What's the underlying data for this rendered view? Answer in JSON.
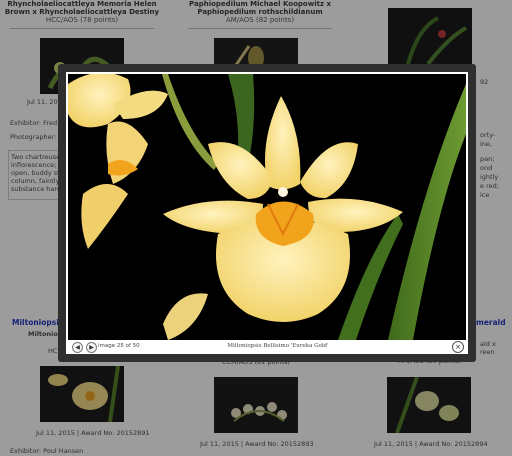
{
  "awards": {
    "col1": {
      "title_line1": "Rhyncholaeliocattleya Memoria Helen",
      "title_line2": "Brown x Rhyncholaeliocattleya Destiny",
      "award": "HCC/AOS (78 points)",
      "date_partial": "Jul 11, 201",
      "exhibitor_partial": "Exhibitor: Fred",
      "photographer_partial": "Photographer: St",
      "desc_line1": "Two chartreuse",
      "desc_line2": "inflorescence; s",
      "desc_line3": "open, buddy sta",
      "desc_line4": "column, faintly r",
      "desc_line5": "substance hard"
    },
    "col2": {
      "title_line1": "Paphiopedilum Michael Koopowitz x",
      "title_line2": "Paphiopedilum rothschildianum",
      "award": "AM/AOS (82 points)"
    },
    "col3": {
      "award_partial": "92",
      "desc_line1": "orty-",
      "desc_line2": "ine,",
      "desc_line3": "pan;",
      "desc_line4": "ond",
      "desc_line5": "ightly",
      "desc_line6": "e red;",
      "desc_line7": "ice"
    },
    "row2": {
      "col1_link_partial": "Miltoniopsis",
      "col1_sub_partial1": "Miltonio",
      "col1_sub_partial2": "HC",
      "col1_date": "Jul 11, 2015 | Award No: 20152891",
      "col1_exhibitor": "Exhibitor: Poul Hansen",
      "col2_award_partial": "CCM/AOS (81 points)",
      "col2_date": "Jul 11, 2015 | Award No: 20152893",
      "col3_link_partial": "merald",
      "col3_sub_partial1": "ald x",
      "col3_sub_partial2": "reen",
      "col3_award_partial": "AM/AOS (80 points)",
      "col3_date": "Jul 11, 2015 | Award No: 20152894"
    }
  },
  "lightbox": {
    "prev_symbol": "◀",
    "next_symbol": "▶",
    "counter": "image 25 of 50",
    "caption": "Miltoniopsis Bellisimo 'Eureka Gold'",
    "close_symbol": "×"
  },
  "colors": {
    "link_blue": "#1a2fbf",
    "flower_yellow": "#f7e08a",
    "flower_center": "#f2a31c",
    "photo_bg": "#000000",
    "leaf_green": "#4f7a22"
  }
}
